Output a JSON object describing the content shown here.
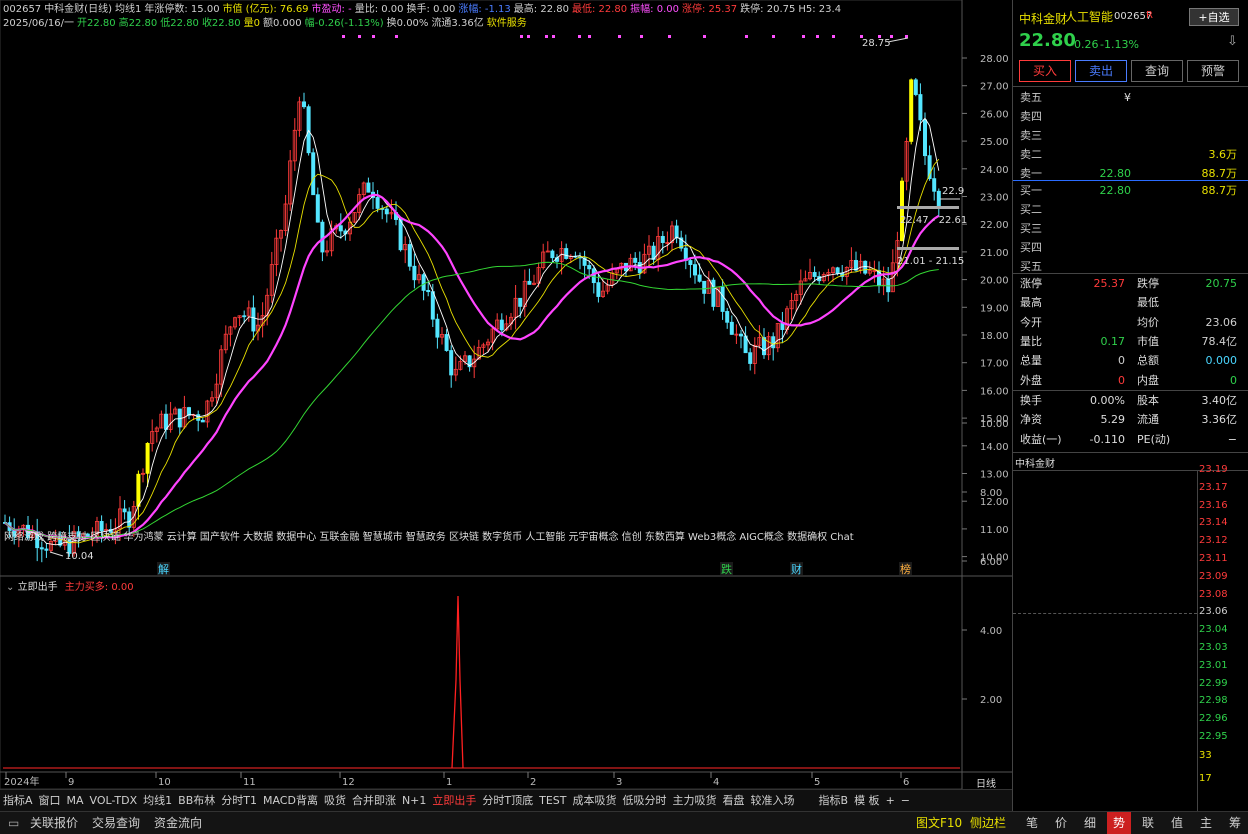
{
  "info_line1": [
    {
      "t": "002657",
      "c": "white"
    },
    {
      "t": "中科金财(日线)",
      "c": "white"
    },
    {
      "t": "均线1",
      "c": "white"
    },
    {
      "t": "年涨停数: 15.00",
      "c": "white"
    },
    {
      "t": "市值",
      "c": "yellow"
    },
    {
      "t": "(亿元): 76.69",
      "c": "yellow"
    },
    {
      "t": "市盈动: -",
      "c": "mag"
    },
    {
      "t": "量比: 0.00",
      "c": "white"
    },
    {
      "t": "换手: 0.00",
      "c": "white"
    },
    {
      "t": "涨幅: -1.13",
      "c": "blue"
    },
    {
      "t": "最高: 22.80",
      "c": "white"
    },
    {
      "t": "最低: 22.80",
      "c": "red"
    },
    {
      "t": "振幅: 0.00",
      "c": "mag"
    },
    {
      "t": "涨停: 25.37",
      "c": "red"
    },
    {
      "t": "跌停: 20.75",
      "c": "white"
    },
    {
      "t": "H5: 23.4",
      "c": "white"
    }
  ],
  "info_line2": [
    {
      "t": "2025/06/16/一",
      "c": "white"
    },
    {
      "t": "开22.80",
      "c": "green"
    },
    {
      "t": "高22.80",
      "c": "green"
    },
    {
      "t": "低22.80",
      "c": "green"
    },
    {
      "t": "收22.80",
      "c": "green"
    },
    {
      "t": "量0",
      "c": "yellow"
    },
    {
      "t": "额0.000",
      "c": "white"
    },
    {
      "t": "幅-0.26(-1.13%)",
      "c": "green"
    },
    {
      "t": "换0.00%",
      "c": "white"
    },
    {
      "t": "流通3.36亿",
      "c": "white"
    },
    {
      "t": "软件服务",
      "c": "yellow"
    }
  ],
  "price_axis": [
    "28.00",
    "27.00",
    "26.00",
    "25.00",
    "24.00",
    "23.00",
    "22.00",
    "21.00",
    "20.00",
    "19.00",
    "18.00",
    "17.00",
    "16.00",
    "15.00",
    "14.00",
    "13.00",
    "12.00",
    "11.00",
    "10.00"
  ],
  "sub_axis": [
    "10.00",
    "8.00",
    "6.00",
    "4.00",
    "2.00"
  ],
  "time_axis": [
    "2024年",
    "9",
    "10",
    "11",
    "12",
    "1",
    "2",
    "3",
    "4",
    "5",
    "6"
  ],
  "period_label": "日线",
  "annotations": {
    "high": "28.75",
    "low": "10.04",
    "last": "22.9",
    "range1": "22.47 - 22.61",
    "range2": "21.01 - 21.15"
  },
  "concepts": "网络游戏 跨境支付 区块链 华为鸿蒙 云计算 国产软件 大数据 数据中心 互联金融 智慧城市 智慧政务 区块链 数字货币 人工智能 元宇宙概念 信创 东数西算 Web3概念 AIGC概念 数据确权 Chat",
  "event_markers": [
    "解",
    "跌",
    "财",
    "榜"
  ],
  "sub_indicator": {
    "name": "立即出手",
    "value": "主力买多: 0.00"
  },
  "toolbar": [
    "指标A",
    "窗口",
    "MA",
    "VOL-TDX",
    "均线1",
    "BB布林",
    "分时T1",
    "MACD背离",
    "吸货",
    "合并即涨",
    "N+1",
    "立即出手",
    "分时T顶底",
    "TEST",
    "成本吸货",
    "低吸分时",
    "主力吸货",
    "看盘",
    "较准入场",
    "指标B",
    "模 板",
    "+",
    "−"
  ],
  "toolbar_active": "立即出手",
  "bottom_left": [
    "关联报价",
    "交易查询",
    "资金流向"
  ],
  "bottom_right": [
    "图文F10",
    "侧边栏",
    "笔",
    "价",
    "细",
    "势",
    "联",
    "值",
    "主",
    "筹"
  ],
  "bottom_active": "势",
  "quote": {
    "name": "中科金财",
    "concept": "人工智能",
    "code": "002657",
    "flag": "R",
    "self_select": "+自选",
    "price": "22.80",
    "change": "-0.26",
    "pct": "-1.13%",
    "buttons": [
      "买入",
      "卖出",
      "查询",
      "预警"
    ],
    "asks": [
      {
        "k": "卖五",
        "p": "¥",
        "v": ""
      },
      {
        "k": "卖四",
        "p": "",
        "v": ""
      },
      {
        "k": "卖三",
        "p": "",
        "v": ""
      },
      {
        "k": "卖二",
        "p": "",
        "v": "3.6万"
      },
      {
        "k": "卖一",
        "p": "22.80",
        "v": "88.7万"
      }
    ],
    "bids": [
      {
        "k": "买一",
        "p": "22.80",
        "v": "88.7万"
      },
      {
        "k": "买二",
        "p": "",
        "v": ""
      },
      {
        "k": "买三",
        "p": "",
        "v": ""
      },
      {
        "k": "买四",
        "p": "",
        "v": ""
      },
      {
        "k": "买五",
        "p": "",
        "v": ""
      }
    ],
    "stats": [
      {
        "k1": "涨停",
        "v1": "25.37",
        "c1": "red",
        "k2": "跌停",
        "v2": "20.75",
        "c2": "green"
      },
      {
        "k1": "最高",
        "v1": "",
        "c1": "white",
        "k2": "最低",
        "v2": "",
        "c2": "white"
      },
      {
        "k1": "今开",
        "v1": "",
        "c1": "white",
        "k2": "均价",
        "v2": "23.06",
        "c2": "white"
      },
      {
        "k1": "量比",
        "v1": "0.17",
        "c1": "green",
        "k2": "市值",
        "v2": "78.4亿",
        "c2": "white"
      },
      {
        "k1": "总量",
        "v1": "0",
        "c1": "white",
        "k2": "总额",
        "v2": "0.000",
        "c2": "cyan"
      },
      {
        "k1": "外盘",
        "v1": "0",
        "c1": "red",
        "k2": "内盘",
        "v2": "0",
        "c2": "green"
      }
    ],
    "stats2": [
      {
        "k1": "换手",
        "v1": "0.00%",
        "k2": "股本",
        "v2": "3.40亿"
      },
      {
        "k1": "净资",
        "v1": "5.29",
        "k2": "流通",
        "v2": "3.36亿"
      },
      {
        "k1": "收益(一)",
        "v1": "-0.110",
        "k2": "PE(动)",
        "v2": "−"
      }
    ],
    "mini_title": "中科金财",
    "mini_axis": [
      {
        "t": "23.19",
        "c": "red"
      },
      {
        "t": "23.17",
        "c": "red"
      },
      {
        "t": "23.16",
        "c": "red"
      },
      {
        "t": "23.14",
        "c": "red"
      },
      {
        "t": "23.12",
        "c": "red"
      },
      {
        "t": "23.11",
        "c": "red"
      },
      {
        "t": "23.09",
        "c": "red"
      },
      {
        "t": "23.08",
        "c": "red"
      },
      {
        "t": "23.06",
        "c": "white"
      },
      {
        "t": "23.04",
        "c": "green"
      },
      {
        "t": "23.03",
        "c": "green"
      },
      {
        "t": "23.01",
        "c": "green"
      },
      {
        "t": "22.99",
        "c": "green"
      },
      {
        "t": "22.98",
        "c": "green"
      },
      {
        "t": "22.96",
        "c": "green"
      },
      {
        "t": "22.95",
        "c": "green"
      },
      {
        "t": "33",
        "c": "yellow"
      },
      {
        "t": "17",
        "c": "yellow"
      }
    ]
  },
  "colors": {
    "up": "#ff3b3b",
    "down": "#54e6ff",
    "ma5": "#ffffff",
    "ma10": "#e8e000",
    "ma20": "#ff44ff",
    "ma60": "#33d633",
    "limit": "#ffff00"
  }
}
